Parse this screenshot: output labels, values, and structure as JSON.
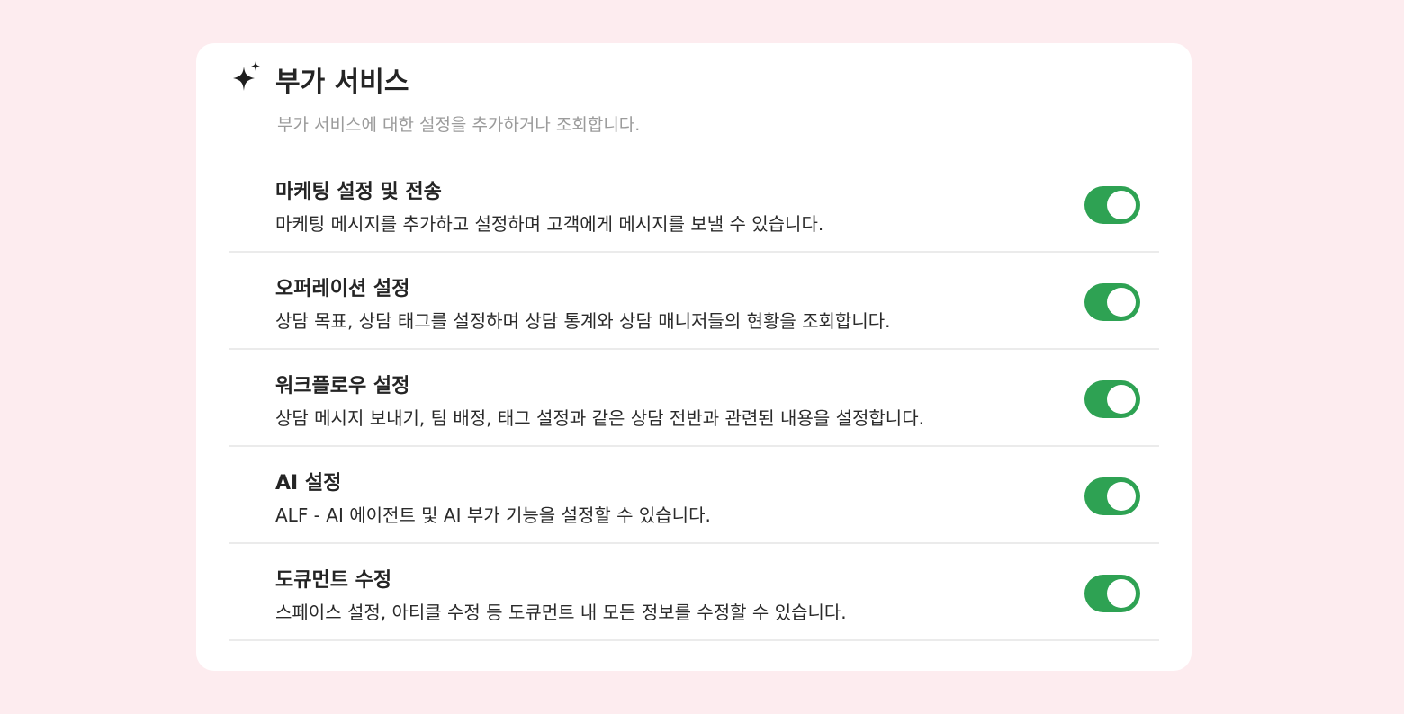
{
  "header": {
    "icon": "sparkles-icon",
    "title": "부가 서비스",
    "subtitle": "부가 서비스에 대한 설정을 추가하거나 조회합니다."
  },
  "items": [
    {
      "title": "마케팅 설정 및 전송",
      "description": "마케팅 메시지를 추가하고 설정하며 고객에게 메시지를 보낼 수 있습니다.",
      "enabled": true
    },
    {
      "title": "오퍼레이션 설정",
      "description": "상담 목표, 상담 태그를 설정하며 상담 통계와 상담 매니저들의 현황을 조회합니다.",
      "enabled": true
    },
    {
      "title": "워크플로우 설정",
      "description": "상담 메시지 보내기, 팀 배정, 태그 설정과 같은 상담 전반과 관련된 내용을 설정합니다.",
      "enabled": true
    },
    {
      "title": "AI 설정",
      "description": "ALF - AI 에이전트 및 AI 부가 기능을 설정할 수 있습니다.",
      "enabled": true
    },
    {
      "title": "도큐먼트 수정",
      "description": "스페이스 설정, 아티클 수정 등 도큐먼트 내 모든 정보를 수정할 수 있습니다.",
      "enabled": true
    }
  ],
  "colors": {
    "background": "#fdecef",
    "card": "#ffffff",
    "toggle_on": "#2ea253",
    "divider": "#ebebeb",
    "subtitle": "#9b9b9b"
  }
}
